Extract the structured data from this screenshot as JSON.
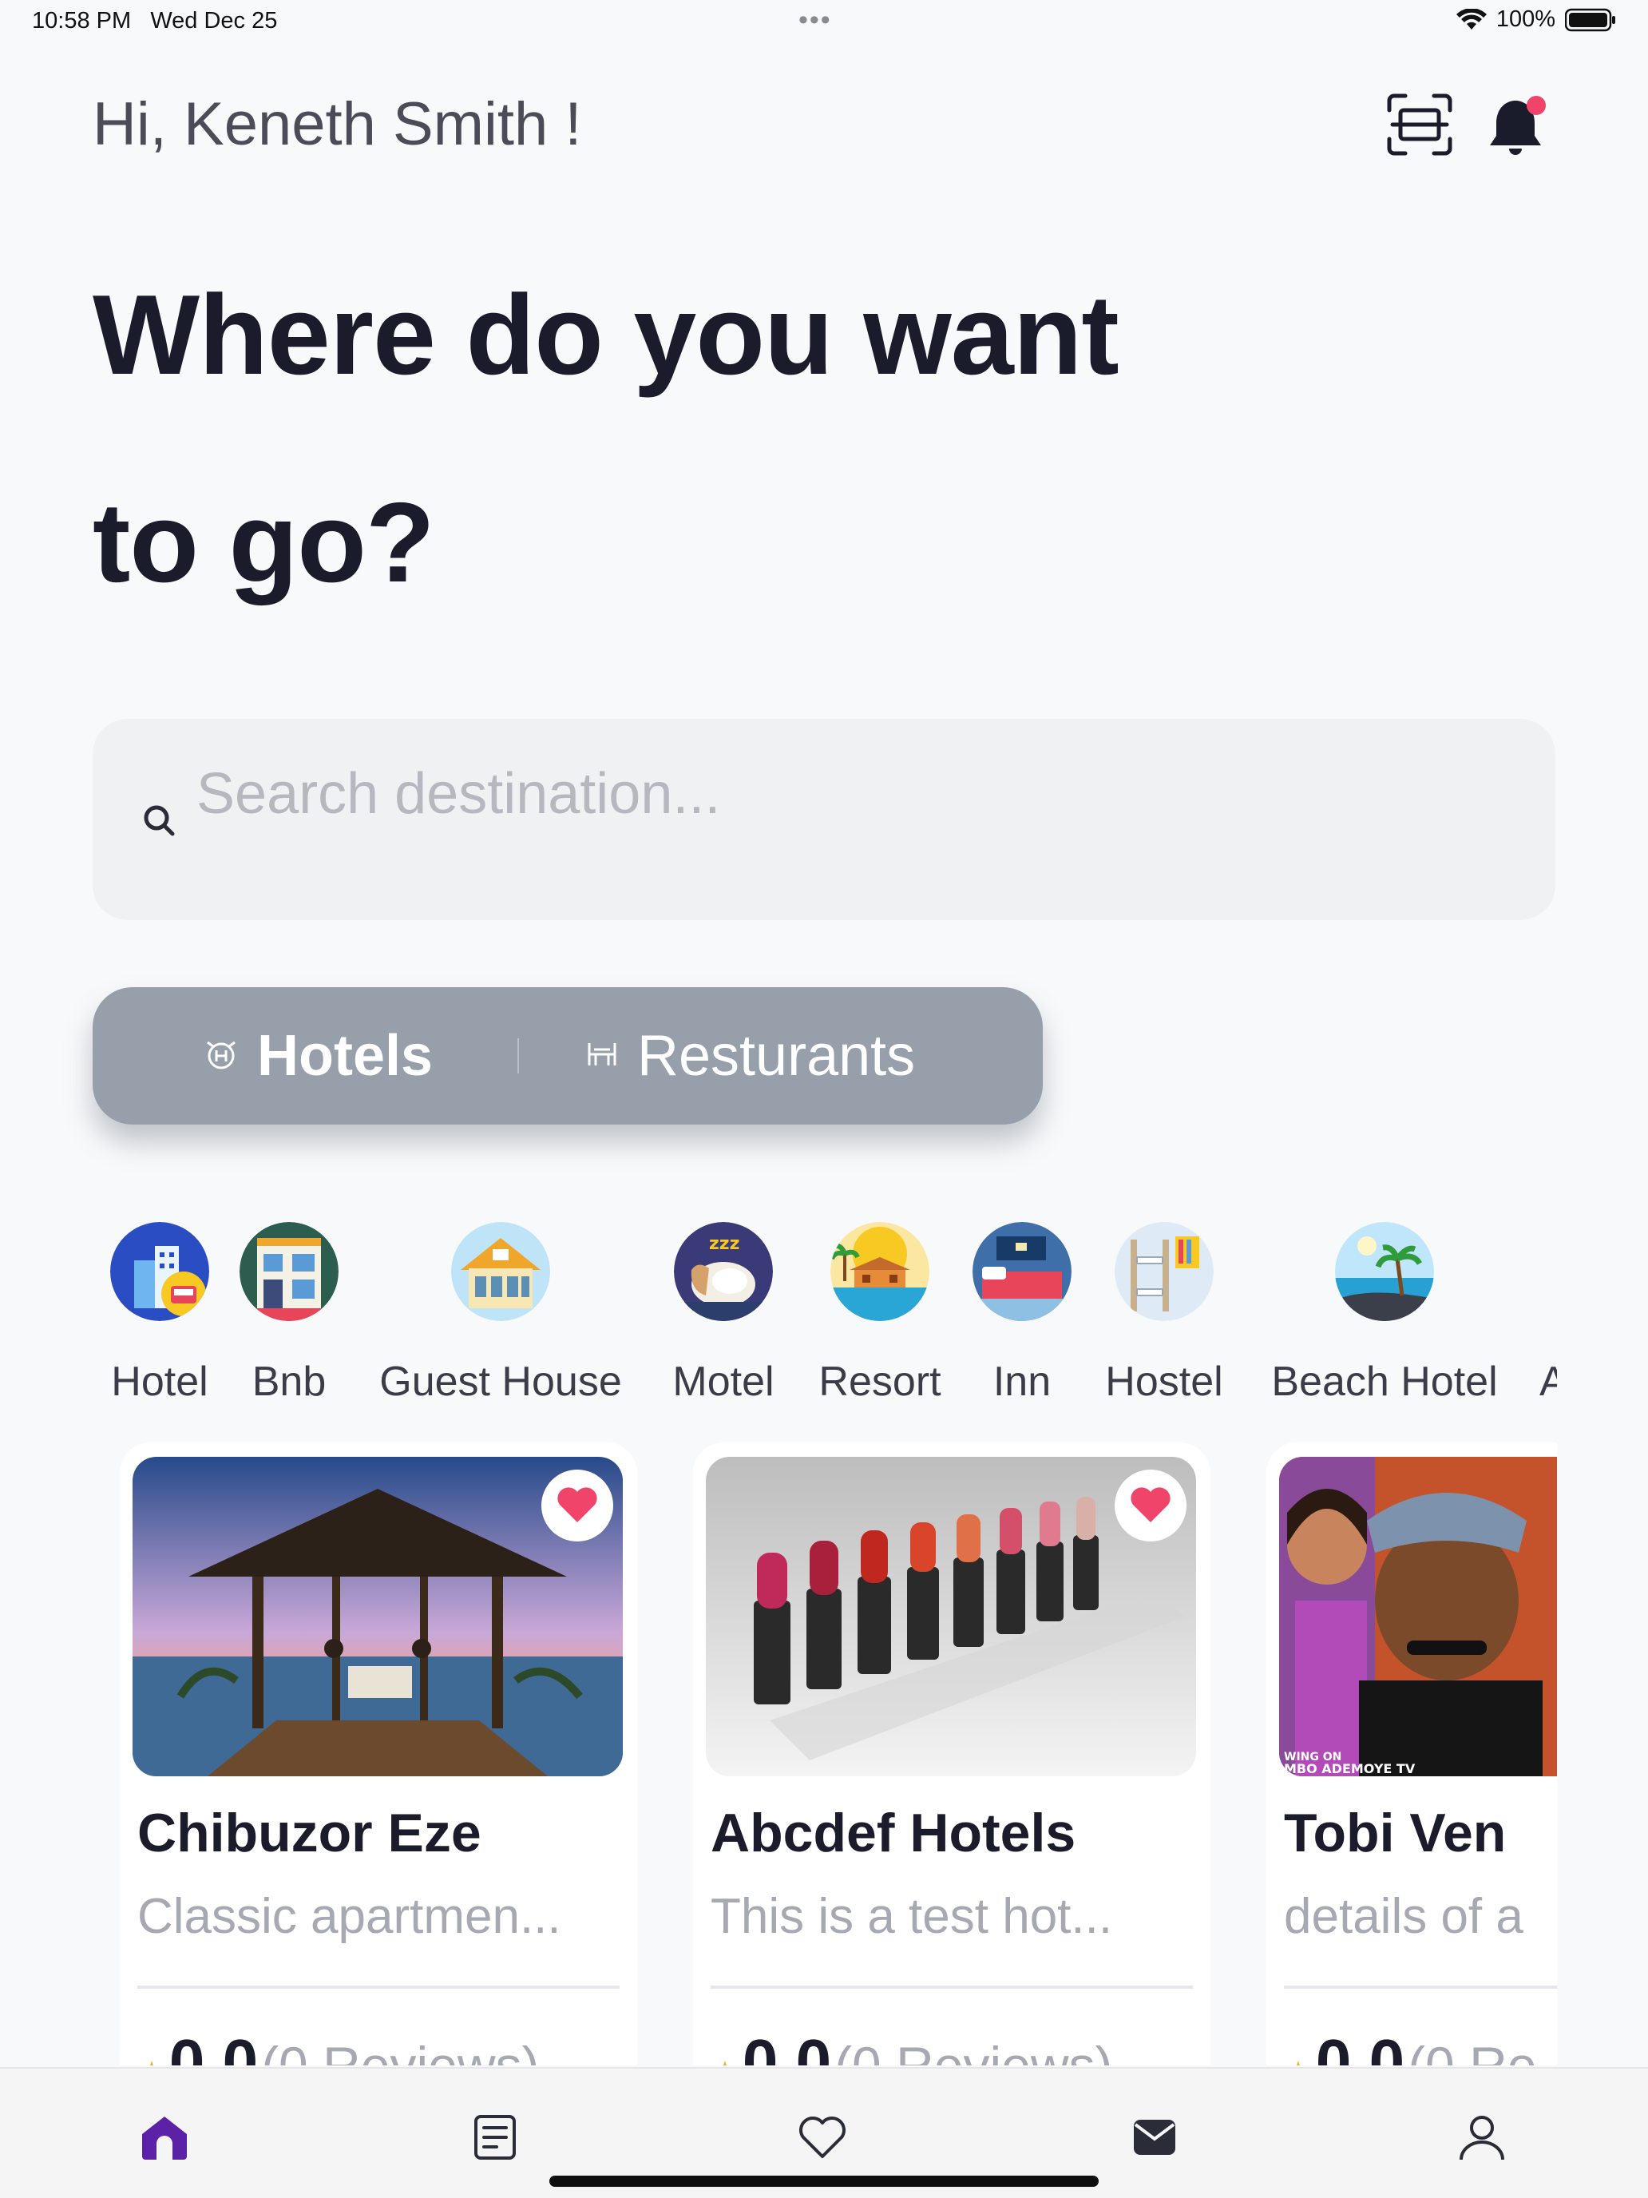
{
  "status_bar": {
    "time": "10:58 PM",
    "date": "Wed Dec 25",
    "battery": "100%"
  },
  "header": {
    "greeting": "Hi, Keneth Smith !",
    "headline_line1": "Where do you want",
    "headline_line2": "to go?"
  },
  "search": {
    "placeholder": "Search destination..."
  },
  "toggle": {
    "hotels_label": "Hotels",
    "restaurants_label": "Resturants",
    "selected": "Hotels"
  },
  "categories": [
    {
      "label": "Hotel",
      "icon": "hotel-icon"
    },
    {
      "label": "Bnb",
      "icon": "bnb-icon"
    },
    {
      "label": "Guest House",
      "icon": "guest-house-icon"
    },
    {
      "label": "Motel",
      "icon": "motel-icon"
    },
    {
      "label": "Resort",
      "icon": "resort-icon"
    },
    {
      "label": "Inn",
      "icon": "inn-icon"
    },
    {
      "label": "Hostel",
      "icon": "hostel-icon"
    },
    {
      "label": "Beach Hotel",
      "icon": "beach-hotel-icon"
    },
    {
      "label": "A",
      "icon": "more-category-icon"
    }
  ],
  "listings": [
    {
      "title": "Chibuzor Eze",
      "description": "Classic apartmen...",
      "rating": "0.0",
      "reviews": "(0 Reviews)",
      "favorited": true
    },
    {
      "title": "Abcdef Hotels",
      "description": "This is a test hot...",
      "rating": "0.0",
      "reviews": "(0 Reviews)",
      "favorited": true
    },
    {
      "title": "Tobi Ven",
      "description": "details of a",
      "rating": "0.0",
      "reviews": "(0 Re",
      "image_caption": "WING ON\nMBO ADEMOYE TV",
      "favorited": false
    }
  ],
  "nav": {
    "items": [
      "home-icon",
      "bookings-icon",
      "favorites-icon",
      "messages-icon",
      "profile-icon"
    ],
    "active": "home-icon",
    "active_color": "#5b21a6"
  },
  "colors": {
    "accent": "#5b21a6",
    "toggle_bg": "#979fab",
    "favorite": "#f0446a",
    "star": "#f2b01e"
  }
}
